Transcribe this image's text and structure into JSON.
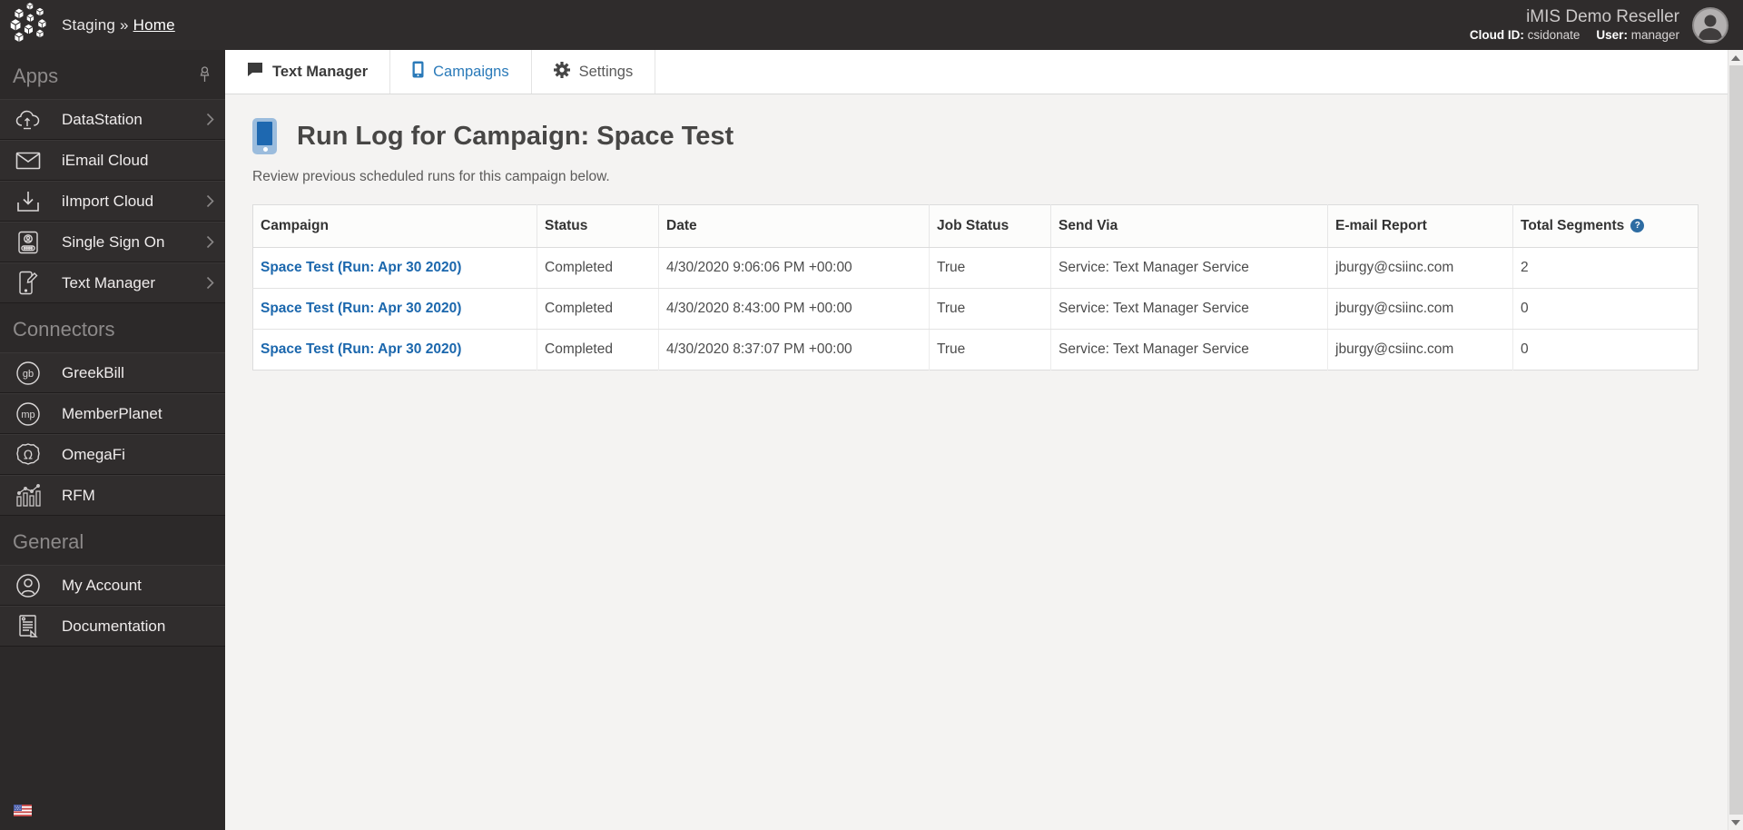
{
  "topbar": {
    "breadcrumb": {
      "section": "Staging",
      "separator": "»",
      "current": "Home"
    },
    "account_name": "iMIS Demo Reseller",
    "cloud_id_label": "Cloud ID:",
    "cloud_id_value": "csidonate",
    "user_label": "User:",
    "user_value": "manager"
  },
  "sidebar": {
    "sections": [
      {
        "title": "Apps",
        "items": [
          {
            "label": "DataStation",
            "icon": "datastation-cloud-icon",
            "has_chevron": true
          },
          {
            "label": "iEmail Cloud",
            "icon": "email-envelope-icon",
            "has_chevron": false
          },
          {
            "label": "iImport Cloud",
            "icon": "import-download-icon",
            "has_chevron": true
          },
          {
            "label": "Single Sign On",
            "icon": "id-card-icon",
            "has_chevron": true
          },
          {
            "label": "Text Manager",
            "icon": "phone-edit-icon",
            "has_chevron": true
          }
        ]
      },
      {
        "title": "Connectors",
        "items": [
          {
            "label": "GreekBill",
            "icon": "greekbill-gb-icon"
          },
          {
            "label": "MemberPlanet",
            "icon": "memberplanet-mp-icon"
          },
          {
            "label": "OmegaFi",
            "icon": "omegafi-omega-icon"
          },
          {
            "label": "RFM",
            "icon": "rfm-chart-icon"
          }
        ]
      },
      {
        "title": "General",
        "items": [
          {
            "label": "My Account",
            "icon": "user-circle-icon"
          },
          {
            "label": "Documentation",
            "icon": "document-icon"
          }
        ]
      }
    ],
    "glyphs": {
      "greekbill": "gb",
      "memberplanet": "mp",
      "omegafi": "Ω"
    }
  },
  "tabs": [
    {
      "label": "Text Manager",
      "icon": "speech-bubble-icon",
      "active": true
    },
    {
      "label": "Campaigns",
      "icon": "mobile-phone-icon",
      "active": false
    },
    {
      "label": "Settings",
      "icon": "gear-icon",
      "active": false
    }
  ],
  "page": {
    "title": "Run Log for Campaign: Space Test",
    "subtitle": "Review previous scheduled runs for this campaign below."
  },
  "table": {
    "headers": [
      "Campaign",
      "Status",
      "Date",
      "Job Status",
      "Send Via",
      "E-mail Report",
      "Total Segments"
    ],
    "help_badge": "?",
    "rows": [
      {
        "campaign": "Space Test (Run: Apr 30 2020)",
        "status": "Completed",
        "date": "4/30/2020 9:06:06 PM +00:00",
        "job_status": "True",
        "send_via": "Service: Text Manager Service",
        "email_report": "jburgy@csiinc.com",
        "total_segments": "2"
      },
      {
        "campaign": "Space Test (Run: Apr 30 2020)",
        "status": "Completed",
        "date": "4/30/2020 8:43:00 PM +00:00",
        "job_status": "True",
        "send_via": "Service: Text Manager Service",
        "email_report": "jburgy@csiinc.com",
        "total_segments": "0"
      },
      {
        "campaign": "Space Test (Run: Apr 30 2020)",
        "status": "Completed",
        "date": "4/30/2020 8:37:07 PM +00:00",
        "job_status": "True",
        "send_via": "Service: Text Manager Service",
        "email_report": "jburgy@csiinc.com",
        "total_segments": "0"
      }
    ]
  },
  "colors": {
    "topbar_bg": "#2f2c2c",
    "sidebar_bg": "#2c2929",
    "main_bg": "#f4f3f2",
    "link_blue": "#1b67ad",
    "tab_blue": "#2a7ab9",
    "help_badge_bg": "#2d6ca2"
  }
}
